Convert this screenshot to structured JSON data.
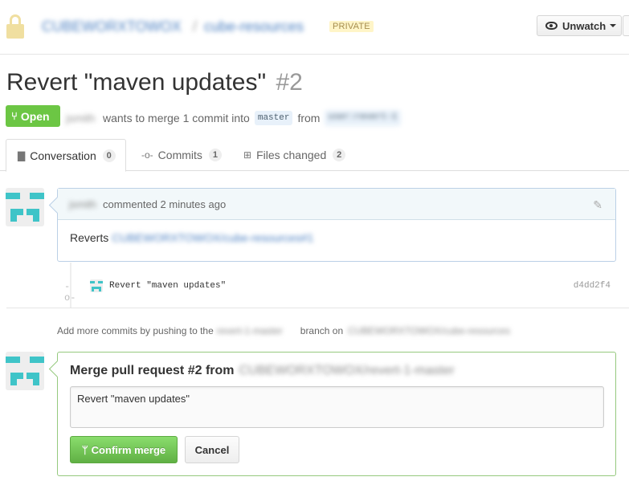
{
  "repo": {
    "owner": "CUBEWORXTOWOX",
    "separator": "/",
    "name": "cube-resources",
    "visibility": "PRIVATE",
    "lock_icon": "lock-icon"
  },
  "watch": {
    "label": "Unwatch",
    "icon": "eye-icon"
  },
  "pr": {
    "title": "Revert \"maven updates\"",
    "number": "#2",
    "state": "Open",
    "author": "jsmith",
    "summary": "wants to merge 1 commit into",
    "base_branch": "master",
    "from_text": "from",
    "head_branch": "user:revert-1"
  },
  "tabs": [
    {
      "label": "Conversation",
      "count": "0",
      "icon": "comment-discussion-icon"
    },
    {
      "label": "Commits",
      "count": "1",
      "icon": "git-commit-icon"
    },
    {
      "label": "Files changed",
      "count": "2",
      "icon": "diff-icon"
    }
  ],
  "comment": {
    "author": "jsmith",
    "meta": "commented 2 minutes ago",
    "body_prefix": "Reverts",
    "body_ref": "CUBEWORXTOWOX/cube-resources#1"
  },
  "commit": {
    "message": "Revert \"maven updates\"",
    "sha": "d4dd2f4"
  },
  "push_hint": {
    "prefix": "Add more commits by pushing to the",
    "branch": "revert-1-master",
    "middle": "branch on",
    "repo": "CUBEWORXTOWOX/cube-resources"
  },
  "merge": {
    "title": "Merge pull request #2 from",
    "source": "CUBEWORXTOWOX/revert-1-master",
    "message": "Revert \"maven updates\"",
    "confirm_label": "Confirm merge",
    "cancel_label": "Cancel"
  },
  "colors": {
    "open_green": "#6cc644",
    "merge_border": "#95c97e",
    "comment_border": "#bbd0e6",
    "identicon": "#3fc4c8"
  }
}
